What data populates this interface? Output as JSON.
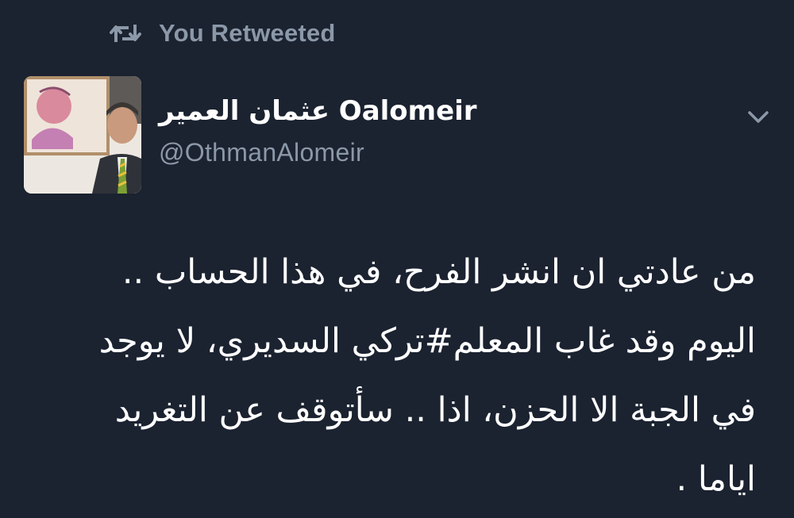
{
  "retweet_banner": {
    "icon": "retweet-icon",
    "text": "You Retweeted"
  },
  "tweet": {
    "author": {
      "avatar": "avatar",
      "display_name": "عثمان العمير Oalomeir",
      "handle": "@OthmanAlomeir"
    },
    "menu_icon": "chevron-down-icon",
    "text_lines": [
      "من عادتي ان انشر الفرح، في هذا الحساب ..",
      "اليوم  وقد غاب  المعلم#تركي السديري، لا يوجد",
      "في الجبة الا الحزن، اذا .. سأتوقف عن التغريد",
      "اياما ."
    ]
  },
  "colors": {
    "background": "#1b2230",
    "muted_text": "#8b98a8",
    "primary_text": "#ffffff"
  }
}
